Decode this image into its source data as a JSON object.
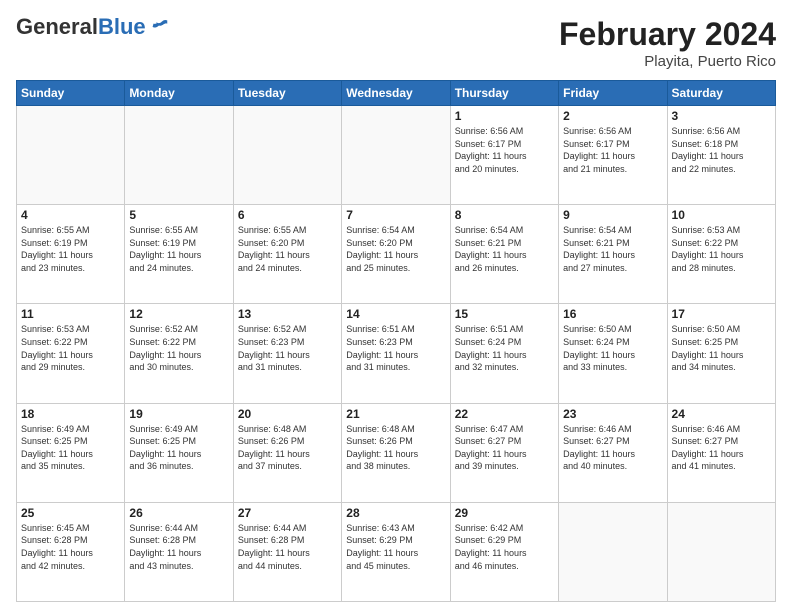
{
  "header": {
    "logo_general": "General",
    "logo_blue": "Blue",
    "title": "February 2024",
    "subtitle": "Playita, Puerto Rico"
  },
  "columns": [
    "Sunday",
    "Monday",
    "Tuesday",
    "Wednesday",
    "Thursday",
    "Friday",
    "Saturday"
  ],
  "weeks": [
    [
      {
        "day": "",
        "info": ""
      },
      {
        "day": "",
        "info": ""
      },
      {
        "day": "",
        "info": ""
      },
      {
        "day": "",
        "info": ""
      },
      {
        "day": "1",
        "info": "Sunrise: 6:56 AM\nSunset: 6:17 PM\nDaylight: 11 hours\nand 20 minutes."
      },
      {
        "day": "2",
        "info": "Sunrise: 6:56 AM\nSunset: 6:17 PM\nDaylight: 11 hours\nand 21 minutes."
      },
      {
        "day": "3",
        "info": "Sunrise: 6:56 AM\nSunset: 6:18 PM\nDaylight: 11 hours\nand 22 minutes."
      }
    ],
    [
      {
        "day": "4",
        "info": "Sunrise: 6:55 AM\nSunset: 6:19 PM\nDaylight: 11 hours\nand 23 minutes."
      },
      {
        "day": "5",
        "info": "Sunrise: 6:55 AM\nSunset: 6:19 PM\nDaylight: 11 hours\nand 24 minutes."
      },
      {
        "day": "6",
        "info": "Sunrise: 6:55 AM\nSunset: 6:20 PM\nDaylight: 11 hours\nand 24 minutes."
      },
      {
        "day": "7",
        "info": "Sunrise: 6:54 AM\nSunset: 6:20 PM\nDaylight: 11 hours\nand 25 minutes."
      },
      {
        "day": "8",
        "info": "Sunrise: 6:54 AM\nSunset: 6:21 PM\nDaylight: 11 hours\nand 26 minutes."
      },
      {
        "day": "9",
        "info": "Sunrise: 6:54 AM\nSunset: 6:21 PM\nDaylight: 11 hours\nand 27 minutes."
      },
      {
        "day": "10",
        "info": "Sunrise: 6:53 AM\nSunset: 6:22 PM\nDaylight: 11 hours\nand 28 minutes."
      }
    ],
    [
      {
        "day": "11",
        "info": "Sunrise: 6:53 AM\nSunset: 6:22 PM\nDaylight: 11 hours\nand 29 minutes."
      },
      {
        "day": "12",
        "info": "Sunrise: 6:52 AM\nSunset: 6:22 PM\nDaylight: 11 hours\nand 30 minutes."
      },
      {
        "day": "13",
        "info": "Sunrise: 6:52 AM\nSunset: 6:23 PM\nDaylight: 11 hours\nand 31 minutes."
      },
      {
        "day": "14",
        "info": "Sunrise: 6:51 AM\nSunset: 6:23 PM\nDaylight: 11 hours\nand 31 minutes."
      },
      {
        "day": "15",
        "info": "Sunrise: 6:51 AM\nSunset: 6:24 PM\nDaylight: 11 hours\nand 32 minutes."
      },
      {
        "day": "16",
        "info": "Sunrise: 6:50 AM\nSunset: 6:24 PM\nDaylight: 11 hours\nand 33 minutes."
      },
      {
        "day": "17",
        "info": "Sunrise: 6:50 AM\nSunset: 6:25 PM\nDaylight: 11 hours\nand 34 minutes."
      }
    ],
    [
      {
        "day": "18",
        "info": "Sunrise: 6:49 AM\nSunset: 6:25 PM\nDaylight: 11 hours\nand 35 minutes."
      },
      {
        "day": "19",
        "info": "Sunrise: 6:49 AM\nSunset: 6:25 PM\nDaylight: 11 hours\nand 36 minutes."
      },
      {
        "day": "20",
        "info": "Sunrise: 6:48 AM\nSunset: 6:26 PM\nDaylight: 11 hours\nand 37 minutes."
      },
      {
        "day": "21",
        "info": "Sunrise: 6:48 AM\nSunset: 6:26 PM\nDaylight: 11 hours\nand 38 minutes."
      },
      {
        "day": "22",
        "info": "Sunrise: 6:47 AM\nSunset: 6:27 PM\nDaylight: 11 hours\nand 39 minutes."
      },
      {
        "day": "23",
        "info": "Sunrise: 6:46 AM\nSunset: 6:27 PM\nDaylight: 11 hours\nand 40 minutes."
      },
      {
        "day": "24",
        "info": "Sunrise: 6:46 AM\nSunset: 6:27 PM\nDaylight: 11 hours\nand 41 minutes."
      }
    ],
    [
      {
        "day": "25",
        "info": "Sunrise: 6:45 AM\nSunset: 6:28 PM\nDaylight: 11 hours\nand 42 minutes."
      },
      {
        "day": "26",
        "info": "Sunrise: 6:44 AM\nSunset: 6:28 PM\nDaylight: 11 hours\nand 43 minutes."
      },
      {
        "day": "27",
        "info": "Sunrise: 6:44 AM\nSunset: 6:28 PM\nDaylight: 11 hours\nand 44 minutes."
      },
      {
        "day": "28",
        "info": "Sunrise: 6:43 AM\nSunset: 6:29 PM\nDaylight: 11 hours\nand 45 minutes."
      },
      {
        "day": "29",
        "info": "Sunrise: 6:42 AM\nSunset: 6:29 PM\nDaylight: 11 hours\nand 46 minutes."
      },
      {
        "day": "",
        "info": ""
      },
      {
        "day": "",
        "info": ""
      }
    ]
  ]
}
